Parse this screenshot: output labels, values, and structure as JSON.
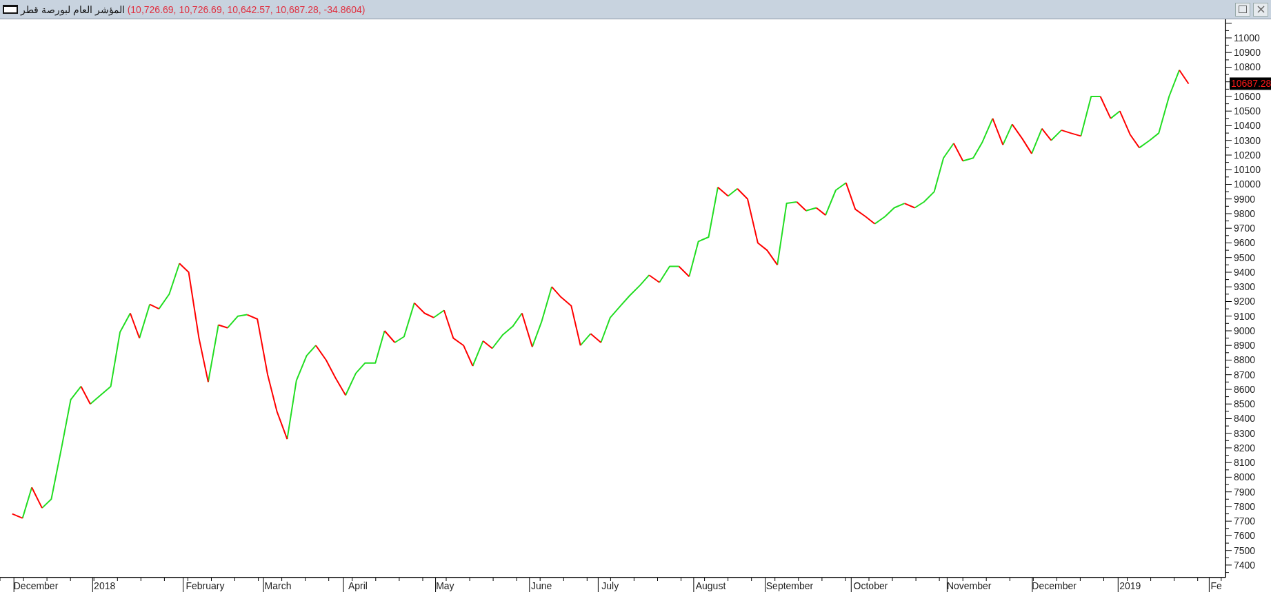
{
  "window": {
    "title": "المؤشر العام لبورصة قطر",
    "quote": "(10,726.69, 10,726.69, 10,642.57, 10,687.28, -34.8604)"
  },
  "chart": {
    "price_badge": "10687.28",
    "chart_data": {
      "type": "line",
      "xlim": [
        2017.898,
        2019.093
      ],
      "ylim": [
        7315,
        11127
      ],
      "x": [
        2017.91,
        2017.92,
        2017.92,
        2017.929,
        2017.929,
        2017.939,
        2017.939,
        2017.948,
        2017.958,
        2017.967,
        2017.977,
        2017.977,
        2017.986,
        2017.986,
        2017.996,
        2018.006,
        2018.015,
        2018.025,
        2018.025,
        2018.034,
        2018.034,
        2018.044,
        2018.044,
        2018.053,
        2018.053,
        2018.063,
        2018.073,
        2018.073,
        2018.082,
        2018.092,
        2018.101,
        2018.101,
        2018.111,
        2018.111,
        2018.12,
        2018.12,
        2018.13,
        2018.139,
        2018.139,
        2018.149,
        2018.159,
        2018.168,
        2018.178,
        2018.178,
        2018.187,
        2018.197,
        2018.206,
        2018.206,
        2018.216,
        2018.225,
        2018.235,
        2018.235,
        2018.245,
        2018.254,
        2018.264,
        2018.273,
        2018.273,
        2018.283,
        2018.283,
        2018.292,
        2018.302,
        2018.302,
        2018.312,
        2018.321,
        2018.321,
        2018.331,
        2018.331,
        2018.34,
        2018.35,
        2018.359,
        2018.359,
        2018.369,
        2018.369,
        2018.378,
        2018.378,
        2018.388,
        2018.398,
        2018.407,
        2018.407,
        2018.417,
        2018.417,
        2018.426,
        2018.436,
        2018.436,
        2018.445,
        2018.455,
        2018.464,
        2018.464,
        2018.474,
        2018.474,
        2018.484,
        2018.484,
        2018.493,
        2018.503,
        2018.512,
        2018.522,
        2018.531,
        2018.531,
        2018.541,
        2018.541,
        2018.551,
        2018.56,
        2018.56,
        2018.57,
        2018.57,
        2018.579,
        2018.589,
        2018.598,
        2018.598,
        2018.608,
        2018.608,
        2018.617,
        2018.617,
        2018.627,
        2018.637,
        2018.646,
        2018.656,
        2018.656,
        2018.665,
        2018.675,
        2018.675,
        2018.684,
        2018.684,
        2018.694,
        2018.694,
        2018.703,
        2018.703,
        2018.713,
        2018.723,
        2018.723,
        2018.732,
        2018.742,
        2018.751,
        2018.751,
        2018.761,
        2018.77,
        2018.78,
        2018.78,
        2018.79,
        2018.79,
        2018.799,
        2018.809,
        2018.818,
        2018.828,
        2018.828,
        2018.837,
        2018.837,
        2018.847,
        2018.856,
        2018.866,
        2018.866,
        2018.876,
        2018.876,
        2018.885,
        2018.885,
        2018.895,
        2018.904,
        2018.904,
        2018.914,
        2018.914,
        2018.923,
        2018.923,
        2018.933,
        2018.933,
        2018.942,
        2018.952,
        2018.952,
        2018.962,
        2018.971,
        2018.971,
        2018.981,
        2018.981,
        2018.99,
        2018.99,
        2019.0,
        2019.009,
        2019.009,
        2019.019,
        2019.028,
        2019.038,
        2019.048,
        2019.048,
        2019.057
      ],
      "yticks": [
        7400,
        7500,
        7600,
        7700,
        7800,
        7900,
        8000,
        8100,
        8200,
        8300,
        8400,
        8500,
        8600,
        8700,
        8800,
        8900,
        9000,
        9100,
        9200,
        9300,
        9400,
        9500,
        9600,
        9700,
        9800,
        9900,
        10000,
        10100,
        10200,
        10300,
        10400,
        10500,
        10600,
        10800,
        10900,
        11000
      ],
      "xticks": [
        {
          "value": 2017.933,
          "label": "December"
        },
        {
          "value": 2018,
          "label": "2018"
        },
        {
          "value": 2018.098,
          "label": "February"
        },
        {
          "value": 2018.169,
          "label": "March"
        },
        {
          "value": 2018.247,
          "label": "April"
        },
        {
          "value": 2018.332,
          "label": "May"
        },
        {
          "value": 2018.426,
          "label": "June"
        },
        {
          "value": 2018.493,
          "label": "July"
        },
        {
          "value": 2018.591,
          "label": "August"
        },
        {
          "value": 2018.668,
          "label": "September"
        },
        {
          "value": 2018.747,
          "label": "October"
        },
        {
          "value": 2018.843,
          "label": "November"
        },
        {
          "value": 2018.926,
          "label": "December"
        },
        {
          "value": 2019,
          "label": "2019"
        },
        {
          "value": 2019.084,
          "label": "Fe"
        }
      ],
      "series": [
        {
          "color": "#22dd22",
          "values": [
            null,
            null,
            7720,
            7930,
            null,
            null,
            7790,
            7850,
            8200,
            8530,
            8620,
            null,
            null,
            8500,
            8560,
            8620,
            8990,
            9120,
            null,
            null,
            8950,
            9180,
            null,
            null,
            9150,
            9250,
            9460,
            null,
            null,
            null,
            null,
            8650,
            9040,
            null,
            null,
            9020,
            9100,
            9110,
            null,
            null,
            null,
            null,
            null,
            8260,
            8660,
            8830,
            8900,
            null,
            null,
            null,
            null,
            8560,
            8710,
            8780,
            8780,
            9000,
            null,
            null,
            8920,
            8960,
            9190,
            null,
            null,
            null,
            9090,
            9140,
            null,
            null,
            null,
            null,
            8760,
            8930,
            null,
            null,
            8880,
            8970,
            9030,
            9120,
            null,
            null,
            8890,
            9060,
            9300,
            null,
            null,
            null,
            null,
            8900,
            8980,
            null,
            null,
            8920,
            9090,
            9170,
            9240,
            9310,
            9380,
            null,
            null,
            9330,
            9440,
            9440,
            null,
            null,
            9370,
            9610,
            9640,
            9980,
            null,
            null,
            9920,
            9970,
            null,
            null,
            null,
            null,
            null,
            9450,
            9870,
            9880,
            null,
            null,
            9820,
            9840,
            null,
            null,
            9790,
            9960,
            10010,
            null,
            null,
            null,
            null,
            9730,
            9780,
            9840,
            9870,
            null,
            null,
            9840,
            9880,
            9950,
            10180,
            10280,
            null,
            null,
            10160,
            10180,
            10290,
            10450,
            null,
            null,
            10270,
            10410,
            null,
            null,
            null,
            10210,
            10380,
            null,
            null,
            10300,
            10370,
            null,
            null,
            null,
            10330,
            10600,
            10600,
            null,
            null,
            10450,
            10500,
            null,
            null,
            null,
            10250,
            10300,
            10350,
            10600,
            10780,
            null,
            null
          ]
        },
        {
          "color": "#ff0000",
          "values": [
            7750,
            7720,
            null,
            null,
            7930,
            7790,
            null,
            null,
            null,
            null,
            null,
            8620,
            8500,
            null,
            null,
            null,
            null,
            null,
            9120,
            8950,
            null,
            null,
            9180,
            9150,
            null,
            null,
            null,
            9460,
            9400,
            8950,
            8650,
            null,
            null,
            9040,
            9020,
            null,
            null,
            null,
            9110,
            9080,
            8700,
            8450,
            8260,
            null,
            null,
            null,
            null,
            8900,
            8800,
            8680,
            8560,
            null,
            null,
            null,
            null,
            null,
            9000,
            8920,
            null,
            null,
            null,
            9190,
            9120,
            9090,
            null,
            null,
            9140,
            8950,
            8900,
            8760,
            null,
            null,
            8930,
            8880,
            null,
            null,
            null,
            null,
            9120,
            8890,
            null,
            null,
            null,
            9300,
            9230,
            9170,
            8900,
            null,
            null,
            8980,
            8920,
            null,
            null,
            null,
            null,
            null,
            null,
            9380,
            9330,
            null,
            null,
            null,
            9440,
            9370,
            null,
            null,
            null,
            null,
            9980,
            9920,
            null,
            null,
            9970,
            9900,
            9600,
            9550,
            9450,
            null,
            null,
            null,
            9880,
            9820,
            null,
            null,
            9840,
            9790,
            null,
            null,
            null,
            10010,
            9830,
            9780,
            9730,
            null,
            null,
            null,
            null,
            9870,
            9840,
            null,
            null,
            null,
            null,
            null,
            10280,
            10160,
            null,
            null,
            null,
            null,
            10450,
            10270,
            null,
            null,
            10410,
            10310,
            10210,
            null,
            null,
            10380,
            10300,
            null,
            null,
            10370,
            10350,
            10330,
            null,
            null,
            null,
            10600,
            10450,
            null,
            null,
            10500,
            10340,
            10250,
            null,
            null,
            null,
            null,
            null,
            10780,
            10687
          ]
        }
      ]
    }
  }
}
